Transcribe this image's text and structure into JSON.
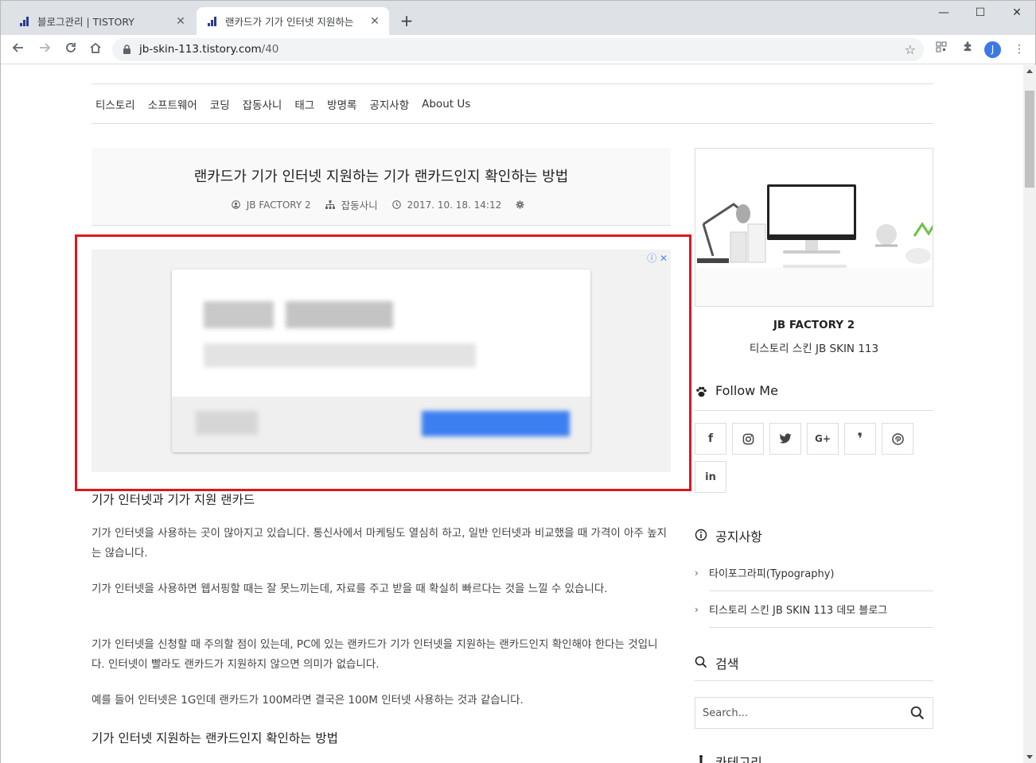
{
  "browser": {
    "tabs": [
      {
        "title": "블로그관리 | TISTORY",
        "active": false
      },
      {
        "title": "랜카드가 기가 인터넷 지원하는",
        "active": true
      }
    ],
    "new_tab": "+",
    "window_controls": {
      "minimize": "—",
      "maximize": "☐",
      "close": "✕"
    },
    "url_host": "jb-skin-113.tistory.com",
    "url_path": "/40",
    "profile_initial": "J"
  },
  "nav": {
    "items": [
      "티스토리",
      "소프트웨어",
      "코딩",
      "잡동사니",
      "태그",
      "방명록",
      "공지사항",
      "About Us"
    ]
  },
  "post": {
    "title": "랜카드가 기가 인터넷 지원하는 기가 랜카드인지 확인하는 방법",
    "author": "JB FACTORY 2",
    "category": "잡동사니",
    "date": "2017. 10. 18. 14:12"
  },
  "ad": {
    "info_icon": "ⓘ",
    "close_icon": "✕"
  },
  "content": {
    "heading1": "기가 인터넷과 기가 지원 랜카드",
    "paragraphs": [
      "기가 인터넷을 사용하는 곳이 많아지고 있습니다. 통신사에서 마케팅도 열심히 하고, 일반 인터넷과 비교했을 때 가격이 아주 높지는 않습니다.",
      "기가 인터넷을 사용하면 웹서핑할 때는 잘 못느끼는데, 자료를 주고 받을 때 확실히 빠르다는 것을 느낄 수 있습니다.",
      "기가 인터넷을 신청할 때 주의할 점이 있는데, PC에 있는 랜카드가 기가 인터넷을 지원하는 랜카드인지 확인해야 한다는 것입니다. 인터넷이 빨라도 랜카드가 지원하지 않으면 의미가 없습니다.",
      "예를 들어 인터넷은 1G인데 랜카드가 100M라면 결국은 100M 인터넷 사용하는 것과 같습니다."
    ],
    "heading2": "기가 인터넷 지원하는 랜카드인지 확인하는 방법"
  },
  "sidebar": {
    "blog_name": "JB FACTORY 2",
    "blog_desc": "티스토리 스킨 JB SKIN 113",
    "follow_title": "Follow Me",
    "social": [
      {
        "icon": "facebook-icon",
        "glyph": "f"
      },
      {
        "icon": "instagram-icon",
        "glyph": "◎"
      },
      {
        "icon": "twitter-icon",
        "glyph": "🐦"
      },
      {
        "icon": "google-plus-icon",
        "glyph": "G+"
      },
      {
        "icon": "tistory-icon",
        "glyph": "❜"
      },
      {
        "icon": "pinterest-icon",
        "glyph": "℗"
      },
      {
        "icon": "linkedin-icon",
        "glyph": "in"
      }
    ],
    "notice_title": "공지사항",
    "notices": [
      "타이포그라피(Typography)",
      "티스토리 스킨 JB SKIN 113 데모 블로그"
    ],
    "search_title": "검색",
    "search_placeholder": "Search...",
    "category_title": "카테고리"
  },
  "colors": {
    "highlight_border": "#e0161e",
    "ad_button": "#3c7ff0",
    "favicon": "#2b3a8f"
  }
}
